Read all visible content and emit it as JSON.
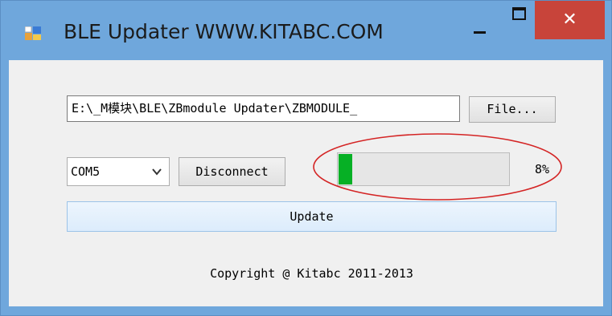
{
  "window": {
    "title": "BLE Updater WWW.KITABC.COM",
    "close_glyph": "✕",
    "accent_color": "#6fa7dc",
    "close_color": "#c8443a"
  },
  "form": {
    "file_path": "E:\\_M模块\\BLE\\ZBmodule Updater\\ZBMODULE_",
    "file_button": "File...",
    "com_port": "COM5",
    "disconnect_button": "Disconnect",
    "progress_fraction": 0.08,
    "progress_label": "8%",
    "progress_color": "#06b025",
    "update_button": "Update",
    "copyright": "Copyright @ Kitabc 2011-2013"
  }
}
